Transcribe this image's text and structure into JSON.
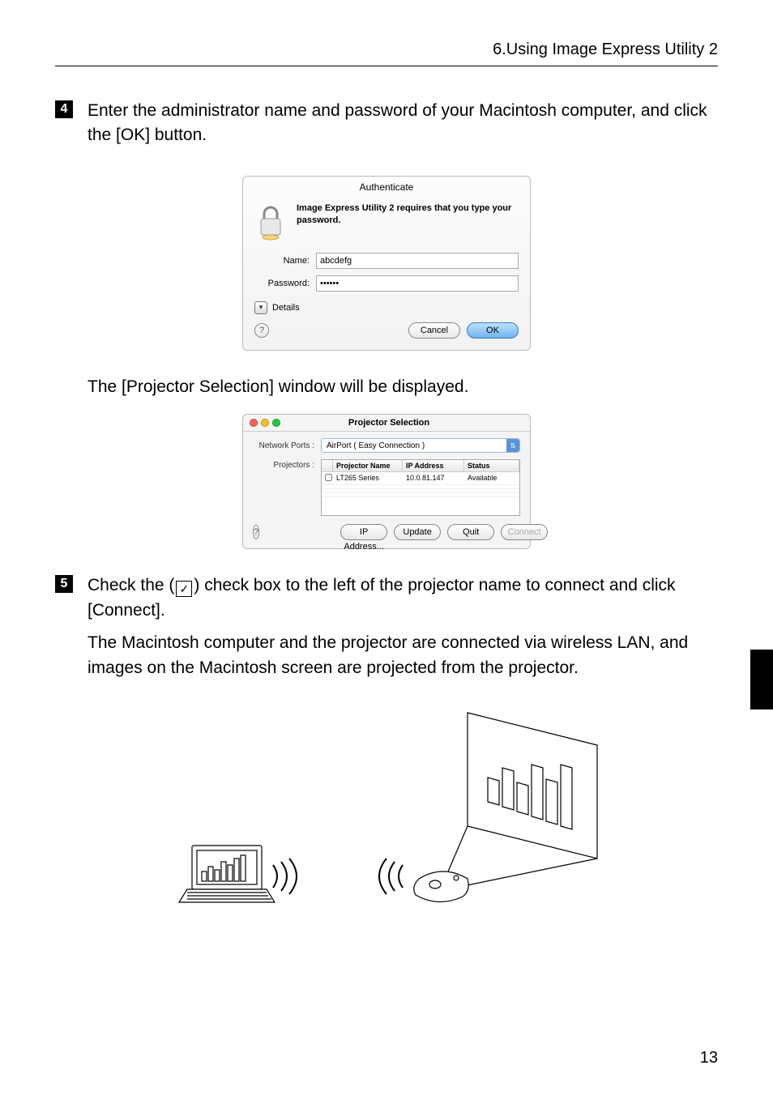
{
  "header": "6.Using Image Express Utility 2",
  "step4": {
    "num": "4",
    "text": "Enter the administrator name and password of your Macintosh computer, and click the [OK] button."
  },
  "auth": {
    "title": "Authenticate",
    "message": "Image Express Utility 2 requires that you type your password.",
    "name_label": "Name:",
    "name_value": "abcdefg",
    "password_label": "Password:",
    "password_value": "••••••",
    "details": "Details",
    "cancel": "Cancel",
    "ok": "OK"
  },
  "after4": "The [Projector Selection] window will be displayed.",
  "proj": {
    "title": "Projector Selection",
    "network_ports_label": "Network Ports :",
    "network_ports_value": "AirPort ( Easy Connection )",
    "projectors_label": "Projectors :",
    "columns": {
      "name": "Projector Name",
      "ip": "IP Address",
      "status": "Status"
    },
    "rows": [
      {
        "name": "LT265 Series",
        "ip": "10.0.81.147",
        "status": "Available"
      }
    ],
    "ip_btn": "IP Address...",
    "update_btn": "Update",
    "quit_btn": "Quit",
    "connect_btn": "Connect"
  },
  "step5": {
    "num": "5",
    "text_before": "Check the (",
    "text_after": ") check box to the left of the projector name to connect and click [Connect].",
    "para": "The Macintosh computer and the projector are connected via wireless LAN, and images on the Macintosh screen are projected from the projector."
  },
  "page_num": "13"
}
